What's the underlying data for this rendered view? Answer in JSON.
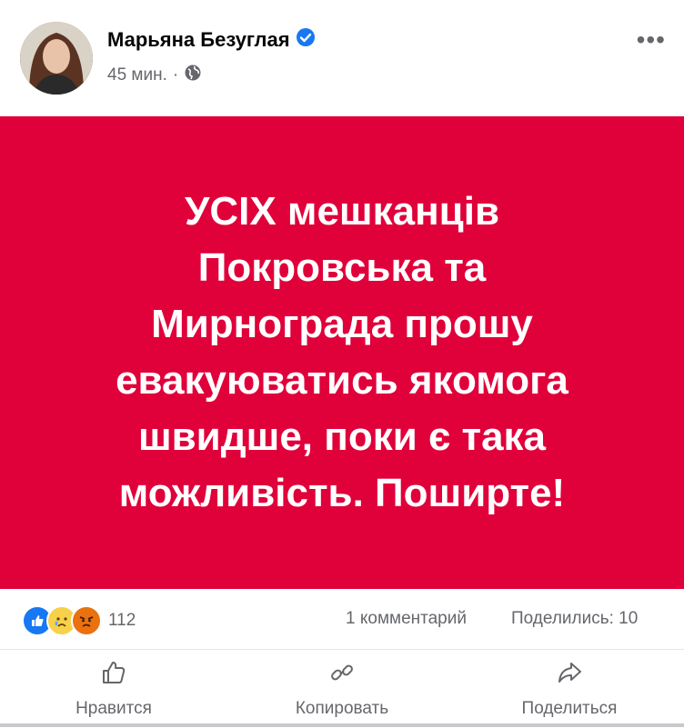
{
  "post": {
    "author": "Марьяна Безуглая",
    "time": "45 мин.",
    "dot": "·",
    "more": "•••"
  },
  "banner": {
    "text": "УСІХ мешканців\nПокровська та\nМирнограда прошу\nевакуюватись якомога\nшвидше, поки є така\nможливість. Поширте!",
    "bg_color": "#e0003a"
  },
  "stats": {
    "reaction_count": "112",
    "comments": "1 комментарий",
    "shares": "Поделились: 10"
  },
  "actions": {
    "like": "Нравится",
    "copy": "Копировать",
    "share": "Поделиться"
  }
}
